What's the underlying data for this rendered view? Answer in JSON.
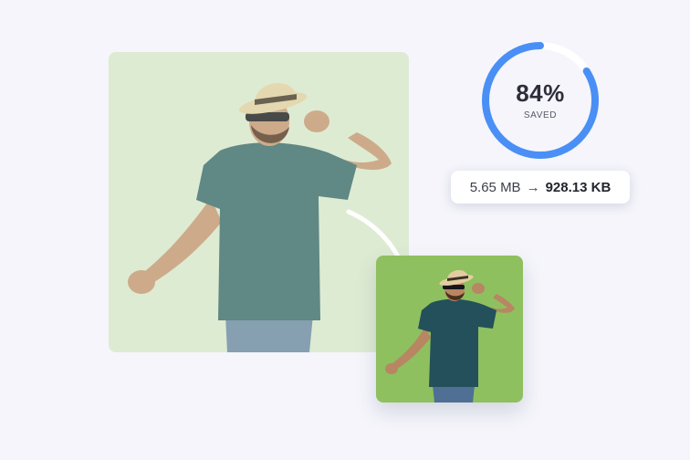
{
  "compression": {
    "percent_label": "84%",
    "saved_label": "SAVED",
    "percent_value": 0.84
  },
  "sizes": {
    "original": "5.65 MB",
    "arrow_glyph": "→",
    "compressed": "928.13 KB"
  },
  "colors": {
    "page_background": "#f5f5fb",
    "original_card_background": "#deebd3",
    "compressed_card_background": "#8ec05f",
    "gauge_track": "#ffffff",
    "gauge_progress": "#4a8ff5"
  },
  "icons": {
    "transition_arrow": "curved-arrow-icon"
  }
}
